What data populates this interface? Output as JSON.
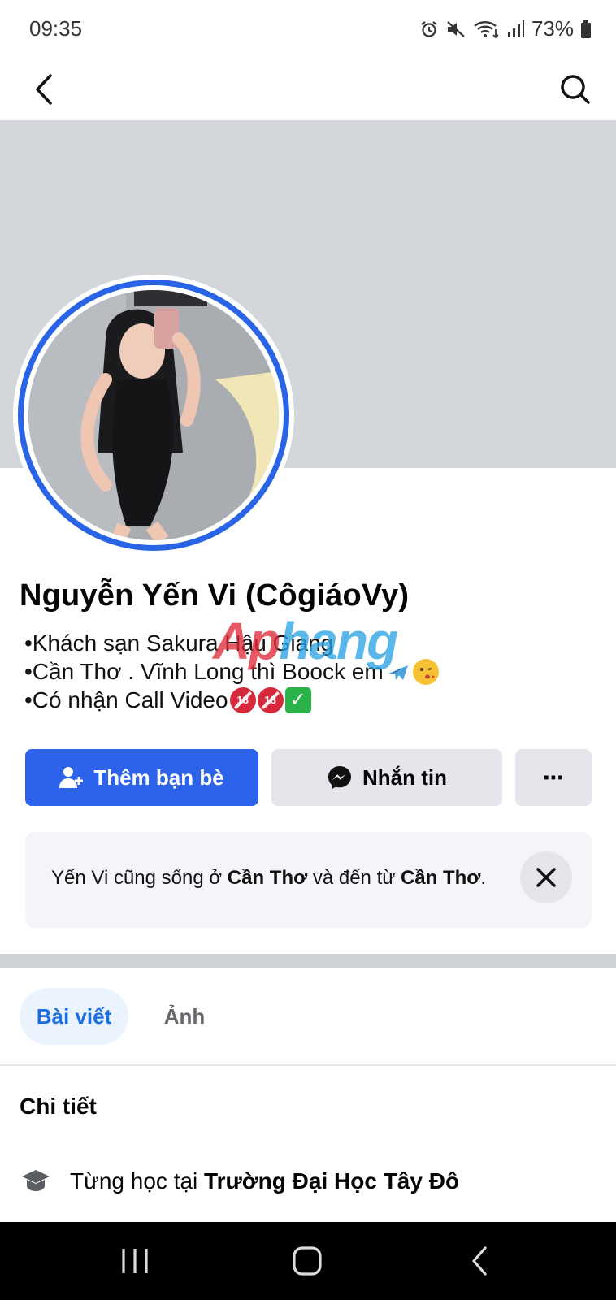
{
  "status_bar": {
    "time": "09:35",
    "battery": "73%",
    "icons": [
      "alarm-icon",
      "mute-icon",
      "wifi-icon",
      "signal-icon",
      "battery-icon"
    ]
  },
  "top_bar": {
    "back_icon": "chevron-left-icon",
    "search_icon": "search-icon"
  },
  "profile": {
    "name": "Nguyễn Yến Vi (CôgiáoVy)",
    "bio": [
      "•Khách sạn Sakura Hậu Giang",
      "•Cần Thơ . Vĩnh Long thì Boock em",
      "•Có nhận Call Video"
    ],
    "watermark_a": "Ap",
    "watermark_b": "hang"
  },
  "actions": {
    "add_friend": "Thêm bạn bè",
    "message": "Nhắn tin",
    "more": "⋯"
  },
  "info_card": {
    "prefix": "Yến Vi cũng sống ở ",
    "city1": "Cần Thơ",
    "middle": " và đến từ ",
    "city2": "Cần Thơ",
    "suffix": "."
  },
  "tabs": [
    {
      "label": "Bài viết",
      "active": true
    },
    {
      "label": "Ảnh",
      "active": false
    }
  ],
  "details": {
    "title": "Chi tiết",
    "education_prefix": "Từng học tại ",
    "education_school": "Trường Đại Học Tây Đô"
  },
  "colors": {
    "primary": "#2d63ea",
    "cover": "#d3d6da",
    "avatar_ring": "#2a64e6"
  }
}
